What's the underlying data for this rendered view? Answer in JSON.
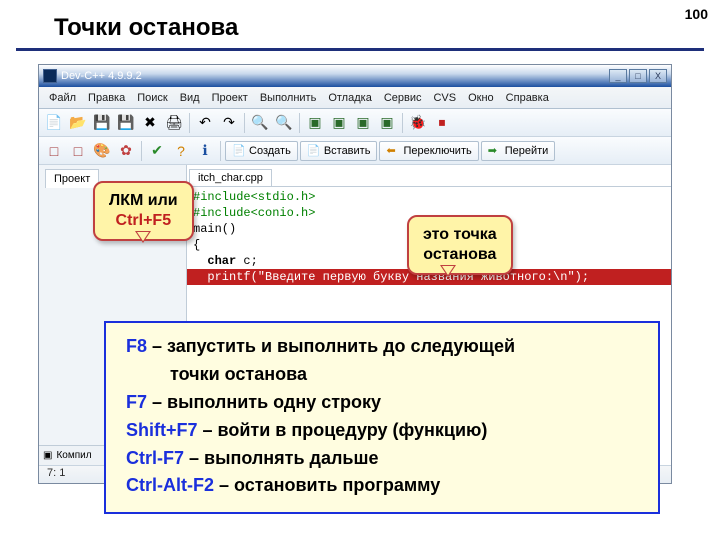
{
  "slide": {
    "number": "100",
    "title": "Точки останова"
  },
  "titlebar": {
    "title": "Dev-C++ 4.9.9.2"
  },
  "window_controls": {
    "min": "_",
    "max": "□",
    "close": "X"
  },
  "menu": {
    "file": "Файл",
    "edit": "Правка",
    "search": "Поиск",
    "view": "Вид",
    "project": "Проект",
    "execute": "Выполнить",
    "debug": "Отладка",
    "tools": "Сервис",
    "cvs": "CVS",
    "window": "Окно",
    "help": "Справка"
  },
  "toolbar2": {
    "create": "Создать",
    "insert": "Вставить",
    "switch": "Переключить",
    "goto": "Перейти"
  },
  "sidebar": {
    "project_tab": "Проект"
  },
  "editor": {
    "file_tab": "itch_char.cpp"
  },
  "code": {
    "l1a": "#include",
    "l1b": "<stdio.h>",
    "l2a": "#include",
    "l2b": "<conio.h>",
    "l3": "",
    "l4": "main()",
    "l5": "{",
    "l6a": "  char",
    "l6b": " c;",
    "l7": "  printf(\"Введите первую букву названия животного:\\n\");"
  },
  "bottom_tabs": {
    "compile": "Компил"
  },
  "status": {
    "pos": "7: 1"
  },
  "callout1": {
    "l1": "ЛКМ или",
    "l2": "Ctrl+F5"
  },
  "callout2": {
    "l1": "это точка",
    "l2": "останова"
  },
  "hotkeys": {
    "f8_key": "F8",
    "f8_txt": " – запустить и выполнить до следующей",
    "f8_txt2": "точки останова",
    "f7_key": "F7",
    "f7_txt": " – выполнить одну строку",
    "sf7_key": "Shift+F7",
    "sf7_txt": " – войти в процедуру (функцию)",
    "cf7_key": "Ctrl-F7",
    "cf7_txt": " – выполнять дальше",
    "caf2_key": "Ctrl-Alt-F2",
    "caf2_txt": " – остановить программу"
  }
}
